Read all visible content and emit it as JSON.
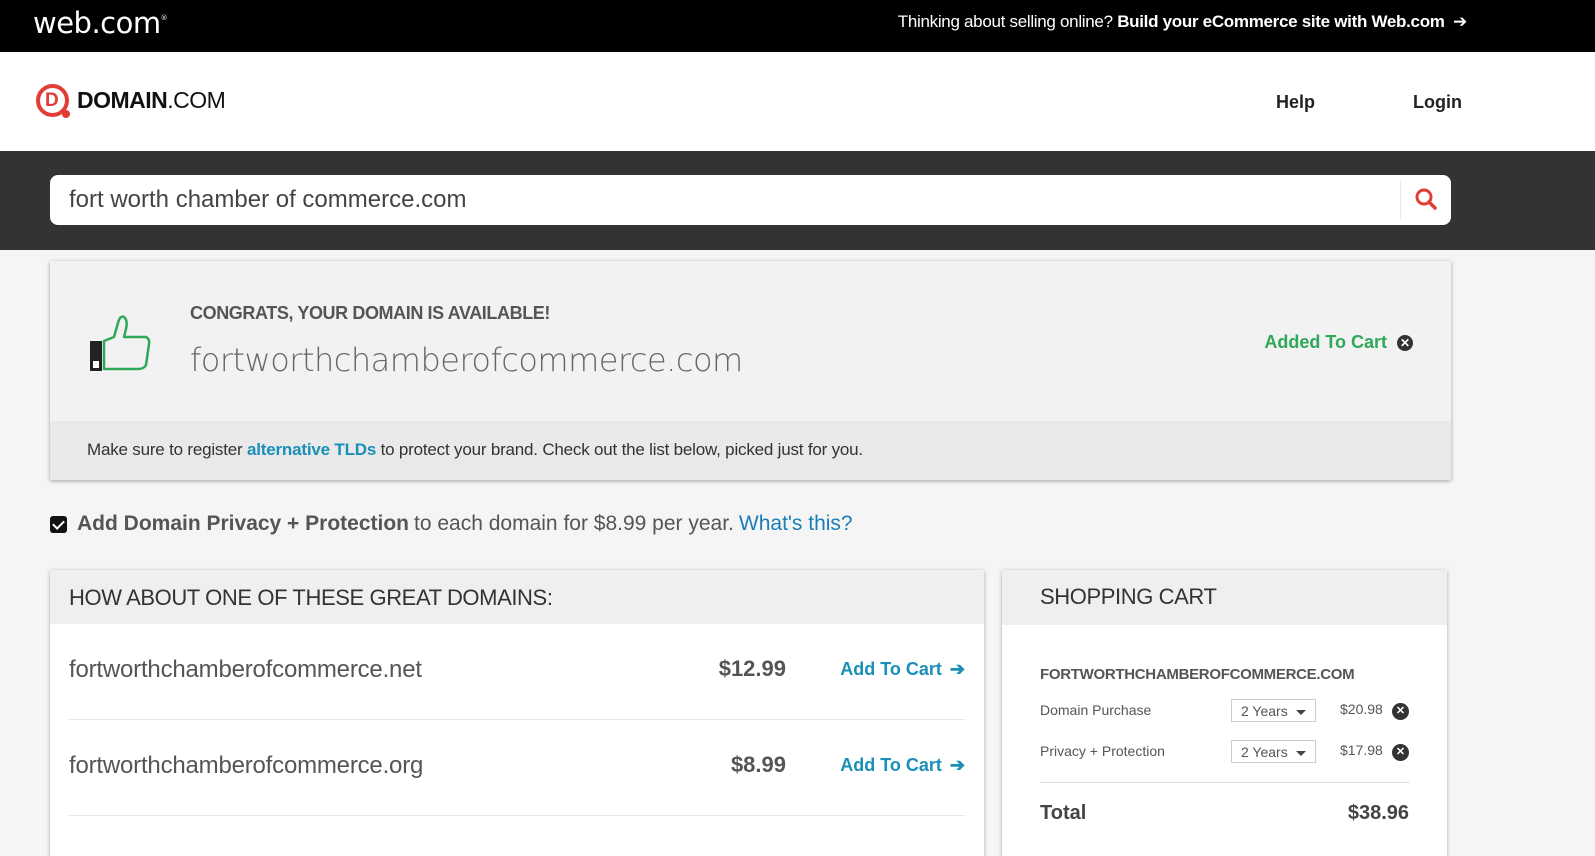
{
  "topbar": {
    "brand": "web.com",
    "promo_lead": "Thinking about selling online?",
    "promo_link": "Build your eCommerce site with Web.com",
    "promo_arrow": "➔"
  },
  "header": {
    "logo_mark": "D",
    "logo_bold": "DOMAIN",
    "logo_light": ".COM",
    "nav": {
      "help": "Help",
      "login": "Login"
    }
  },
  "search": {
    "query": "fort worth chamber of commerce.com",
    "icon": "search-icon",
    "icon_color": "#e13d36"
  },
  "result": {
    "heading": "CONGRATS, YOUR DOMAIN IS AVAILABLE!",
    "domain": "fortworthchamberofcommerce.com",
    "status": "Added To Cart",
    "status_color": "#2fa85a",
    "remove_glyph": "✕",
    "note_before": "Make sure to register",
    "note_link": "alternative TLDs",
    "note_after": "to protect your brand. Check out the list below, picked just for you."
  },
  "privacy": {
    "checked": true,
    "bold": "Add Domain Privacy + Protection",
    "rest": "to each domain for $8.99 per year.",
    "link": "What's this?"
  },
  "suggestions": {
    "heading": "HOW ABOUT ONE OF THESE GREAT DOMAINS:",
    "add_label": "Add To Cart",
    "arrow": "➔",
    "items": [
      {
        "name": "fortworthchamberofcommerce.net",
        "price": "$12.99"
      },
      {
        "name": "fortworthchamberofcommerce.org",
        "price": "$8.99"
      }
    ]
  },
  "cart": {
    "heading": "SHOPPING CART",
    "domain": "FORTWORTHCHAMBEROFCOMMERCE.COM",
    "items": [
      {
        "label": "Domain Purchase",
        "term": "2 Years",
        "amount": "$20.98"
      },
      {
        "label": "Privacy + Protection",
        "term": "2 Years",
        "amount": "$17.98"
      }
    ],
    "remove_glyph": "✕",
    "total_label": "Total",
    "total_value": "$38.96"
  },
  "colors": {
    "link_blue": "#1a8fb8",
    "success_green": "#2fa85a",
    "brand_red": "#e13d36"
  }
}
